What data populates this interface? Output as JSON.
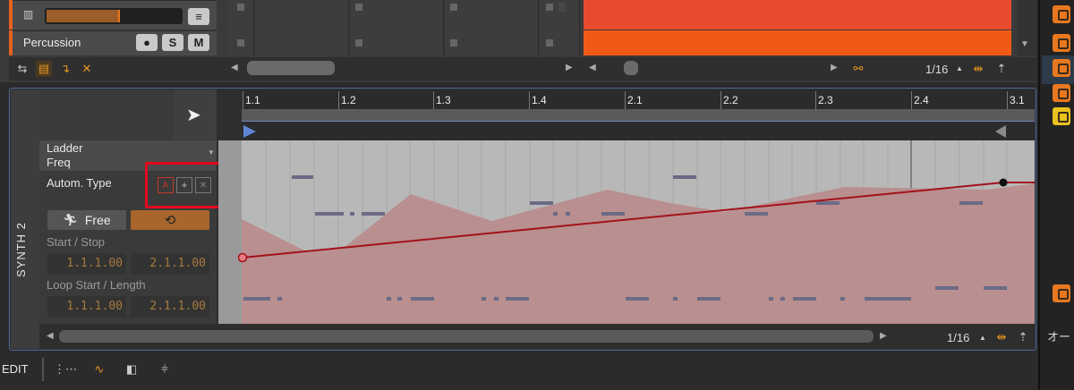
{
  "top": {
    "tracks": [
      {
        "name": "",
        "buttons": [
          "≡"
        ]
      },
      {
        "name": "Percussion",
        "buttons": [
          "●",
          "S",
          "M"
        ]
      }
    ],
    "toolbar_grid": "1/16"
  },
  "detail": {
    "vertical_tab": "SYNTH 2",
    "param_name_line1": "Ladder",
    "param_name_line2": "Freq",
    "autom_type_label": "Autom. Type",
    "free_label": "Free",
    "start_stop_label": "Start / Stop",
    "start_value": "1.1.1.00",
    "stop_value": "2.1.1.00",
    "loop_label": "Loop Start / Length",
    "loop_start_value": "1.1.1.00",
    "loop_length_value": "2.1.1.00",
    "grid": "1/16",
    "ruler": [
      "1.1",
      "1.2",
      "1.3",
      "1.4",
      "2.1",
      "2.2",
      "2.3",
      "2.4",
      "3.1"
    ]
  },
  "bottom": {
    "mode_label": "EDIT"
  },
  "sidebar": {
    "label": "オー"
  },
  "colors": {
    "accent": "#e8781f",
    "automation_line": "#a4121b",
    "highlight": "#e30a1c"
  }
}
